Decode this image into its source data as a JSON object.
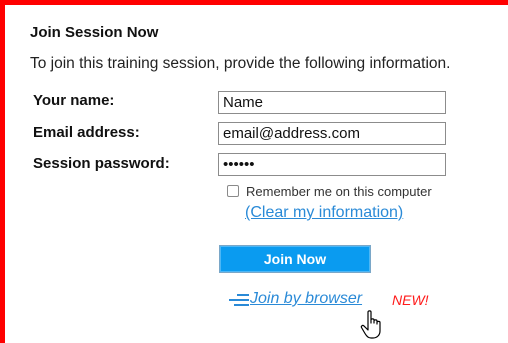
{
  "session": {
    "title": "Join Session Now",
    "intro": "To join this training session, provide the following information."
  },
  "form": {
    "name_label": "Your name:",
    "name_value": "Name",
    "email_label": "Email address:",
    "email_value": "email@address.com",
    "password_label": "Session password:",
    "password_value": "abcdef",
    "remember_label": "Remember me on this computer",
    "remember_checked": false,
    "clear_link": "(Clear my information)"
  },
  "actions": {
    "join_label": "Join Now",
    "browser_link": "Join by browser",
    "new_badge": "NEW!"
  },
  "colors": {
    "frame": "#ff0000",
    "join_button": "#0a9bf0",
    "link": "#2a8ad7",
    "new_badge": "#ff1a1a"
  },
  "icons": {
    "browser": "lines-speed-icon",
    "cursor": "hand-pointer-icon"
  }
}
